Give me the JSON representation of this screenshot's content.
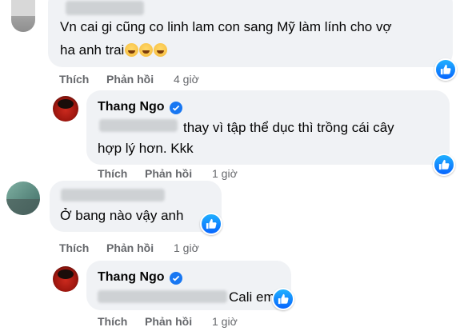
{
  "comments": [
    {
      "text_line1": "Vn cai gi cũng co linh lam con sang Mỹ làm lính cho vợ",
      "text_line2": "ha anh trai",
      "reactions_icon": "laughing-emoji-icon",
      "actions": {
        "like": "Thích",
        "reply": "Phản hồi",
        "time": "4 giờ"
      },
      "reaction_badge": "like-icon"
    },
    {
      "author": "Thang Ngo",
      "verified_icon": "verified-badge-icon",
      "text_line1": "thay vì tập thể dục thì trồng cái cây",
      "text_line2": "hợp lý hơn. Kkk",
      "actions": {
        "like": "Thích",
        "reply": "Phản hồi",
        "time": "1 giờ"
      },
      "reaction_badge": "like-icon"
    },
    {
      "text_line1": "Ở bang nào vậy anh",
      "actions": {
        "like": "Thích",
        "reply": "Phản hồi",
        "time": "1 giờ"
      },
      "reaction_badge": "like-icon"
    },
    {
      "author": "Thang Ngo",
      "verified_icon": "verified-badge-icon",
      "text_line1": "Cali em à",
      "actions": {
        "like": "Thích",
        "reply": "Phản hồi",
        "time": "1 giờ"
      },
      "reaction_badge": "like-icon"
    }
  ],
  "colors": {
    "bubble": "#f0f2f5",
    "accent": "#1877f2",
    "secondary_text": "#65676b"
  }
}
